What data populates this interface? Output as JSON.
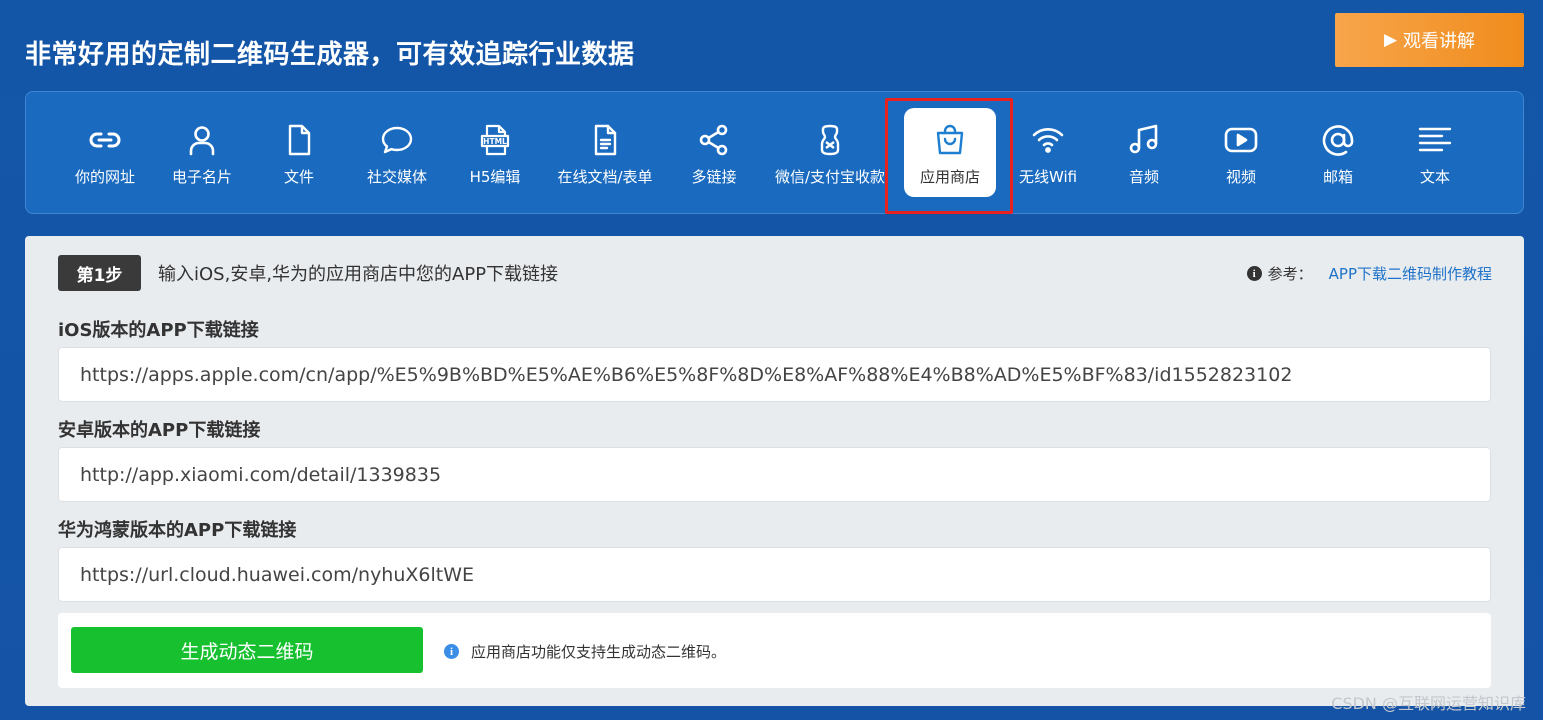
{
  "header": {
    "title": "非常好用的定制二维码生成器，可有效追踪行业数据",
    "watch_button": "观看讲解"
  },
  "types": [
    {
      "label": "你的网址",
      "icon": "link-icon"
    },
    {
      "label": "电子名片",
      "icon": "person-icon"
    },
    {
      "label": "文件",
      "icon": "file-icon"
    },
    {
      "label": "社交媒体",
      "icon": "chat-bubble-icon"
    },
    {
      "label": "H5编辑",
      "icon": "html-icon"
    },
    {
      "label": "在线文档/表单",
      "icon": "document-icon"
    },
    {
      "label": "多链接",
      "icon": "share-icon"
    },
    {
      "label": "微信/支付宝收款",
      "icon": "payment-icon"
    },
    {
      "label": "应用商店",
      "icon": "shopping-bag-icon",
      "active": true
    },
    {
      "label": "无线Wifi",
      "icon": "wifi-icon"
    },
    {
      "label": "音频",
      "icon": "music-note-icon"
    },
    {
      "label": "视频",
      "icon": "play-icon"
    },
    {
      "label": "邮箱",
      "icon": "at-icon"
    },
    {
      "label": "文本",
      "icon": "text-lines-icon"
    }
  ],
  "step": {
    "badge": "第1步",
    "text": "输入iOS,安卓,华为的应用商店中您的APP下载链接",
    "ref_label": "参考：",
    "ref_link": "APP下载二维码制作教程"
  },
  "fields": {
    "ios": {
      "label": "iOS版本的APP下载链接",
      "value": "https://apps.apple.com/cn/app/%E5%9B%BD%E5%AE%B6%E5%8F%8D%E8%AF%88%E4%B8%AD%E5%BF%83/id1552823102"
    },
    "android": {
      "label": "安卓版本的APP下载链接",
      "value": "http://app.xiaomi.com/detail/1339835"
    },
    "huawei": {
      "label": "华为鸿蒙版本的APP下载链接",
      "value": "https://url.cloud.huawei.com/nyhuX6ltWE"
    }
  },
  "generate": {
    "button": "生成动态二维码",
    "note": "应用商店功能仅支持生成动态二维码。"
  },
  "watermark": "CSDN @互联网运营知识库",
  "colors": {
    "background": "#1356a8",
    "type_bar": "#1a6bc0",
    "accent_orange": "#f08c1c",
    "generate_green": "#16c02f",
    "highlight_red": "#e8231f",
    "link_blue": "#1e72c8"
  }
}
